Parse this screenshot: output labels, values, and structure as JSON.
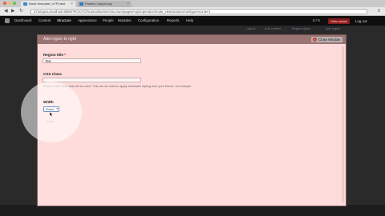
{
  "browser": {
    "tabs": [
      {
        "label": "Node template | d7PLtest",
        "active": true
      },
      {
        "label": "Panels | drupal.org",
        "active": false
      }
    ],
    "url": "d7tutopea.localhost:8888/?ROOT/d7tutorial/admin/structure/pages/nojs/operation/node_view/actions/configure/content"
  },
  "toolbar": {
    "items": [
      {
        "label": "Dashboard",
        "active": false
      },
      {
        "label": "Content",
        "active": false
      },
      {
        "label": "Structure",
        "active": true
      },
      {
        "label": "Appearance",
        "active": false
      },
      {
        "label": "People",
        "active": false
      },
      {
        "label": "Modules",
        "active": false
      },
      {
        "label": "Configuration",
        "active": false
      },
      {
        "label": "Reports",
        "active": false
      },
      {
        "label": "Help",
        "active": false
      }
    ],
    "counter": "0 / 0",
    "hello": "Hello admin",
    "logout": "Log out"
  },
  "page": {
    "links": [
      "Layout",
      "Add content",
      "Region styles",
      "Add region"
    ]
  },
  "modal": {
    "title": "Add region to right",
    "close_label": "Close Window",
    "region_title_label": "Region title",
    "required_mark": "*",
    "region_title_value": "Test",
    "css_class_label": "CSS Class",
    "css_class_value": "",
    "css_description": "Enter a CSS class that will be used. This can be used to apply automatic styling from your theme, for example.",
    "width_label": "Width",
    "width_value": "Fixed",
    "save_label": "Save"
  },
  "colors": {
    "modal_bg": "#ffdcdc",
    "modal_title_bg": "#9a7373",
    "toolbar_bg": "#0f0f0f",
    "hello_badge": "#8a1b1b",
    "close_icon": "#c23a20"
  }
}
